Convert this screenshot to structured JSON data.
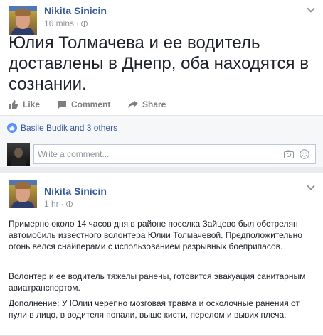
{
  "posts": [
    {
      "author": "Nikita Sinicin",
      "time": "16 mins",
      "text": "Юлия Толмачева и ее водитель доставлены в Днепр, оба находятся в сознании.",
      "actions": {
        "like": "Like",
        "comment": "Comment",
        "share": "Share"
      },
      "likes_text": "Basile Budik and 3 others",
      "comment_placeholder": "Write a comment..."
    },
    {
      "author": "Nikita Sinicin",
      "time": "1 hr",
      "paragraphs": [
        "Примерно около 14 часов дня в районе поселка Зайцево был обстрелян автомобиль известного волонтера Юлии Толмачевой. Предположительно огонь велся снайперами с использованием разрывных боеприпасов.",
        "Волонтер и ее водитель тяжелы ранены, готовится эвакуация санитарным авиатранспортом.",
        "Дополнение: У Юлии черепно мозговая травма и осколочные ранения от пули в лицо, в водителя попали, выше кисти, перелом и вывих плеча."
      ]
    }
  ],
  "icons": {
    "globe": "globe-icon",
    "chevron": "chevron-down-icon",
    "like": "thumbs-up-icon",
    "comment": "comment-bubble-icon",
    "share": "share-arrow-icon",
    "camera": "camera-icon",
    "emoji": "smiley-icon"
  },
  "colors": {
    "link": "#365899",
    "meta": "#90949c",
    "text": "#1d2129",
    "like_badge": "#5890ff"
  }
}
